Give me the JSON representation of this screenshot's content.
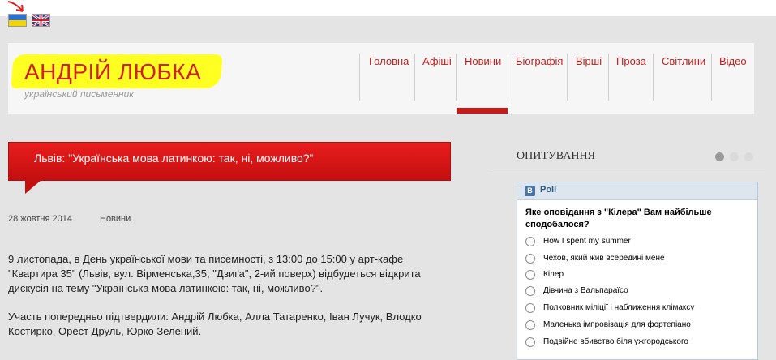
{
  "language_flags": [
    {
      "code": "ua",
      "icon": "ukraine-flag-icon"
    },
    {
      "code": "en",
      "icon": "uk-flag-icon"
    }
  ],
  "site": {
    "title": "АНДРІЙ ЛЮБКА",
    "subtitle": "український письменник"
  },
  "nav": {
    "items": [
      "Головна",
      "Афіші",
      "Новини",
      "Біографія",
      "Вірші",
      "Проза",
      "Світлини",
      "Відео"
    ],
    "active": "Новини"
  },
  "post": {
    "title": "Львів: \"Українська мова латинкою: так, ні, можливо?\"",
    "date": "28 жовтня 2014",
    "category": "Новини",
    "paragraph1": "9 листопада, в День української мови та писемності, з 13:00 до 15:00 у арт-кафе \"Квартира 35\" (Львів, вул. Вірменська,35, \"Дзиґа\", 2-ий поверх) відбудеться відкрита дискусія на тему \"Українська мова латинкою: так, ні, можливо?\".",
    "paragraph2": "Участь попередньо підтвердили: Андрій Любка, Алла Татаренко, Іван Лучук, Влодко Костирко, Орест Друль, Юрко Зелений."
  },
  "sidebar": {
    "title": "ОПИТУВАННЯ",
    "poll": {
      "label": "Poll",
      "question": "Яке оповідання з \"Кілера\" Вам найбільше сподобалося?",
      "options": [
        "How I spent my summer",
        "Чехов, який жив всередині мене",
        "Кілер",
        "Дівчина з Вальпараїсо",
        "Полковник міліції і наближення клімаксу",
        "Маленька імпровізація для фортепіано",
        "Подвійне вбивство біля ужгородського"
      ]
    }
  },
  "colors": {
    "accent": "#c61b1b",
    "highlight": "#ffff22",
    "vk": "#4c75a3"
  }
}
